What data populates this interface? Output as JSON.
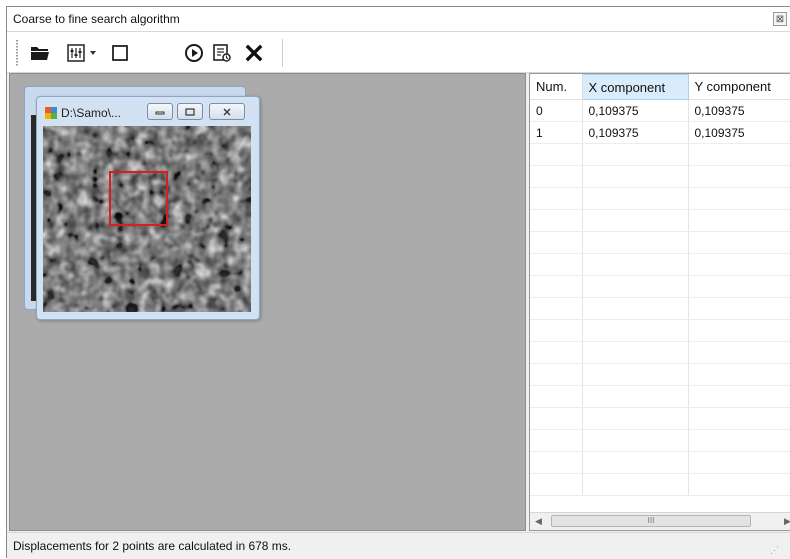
{
  "window": {
    "title": "Coarse to fine search algorithm",
    "title_button_glyph": "⊠"
  },
  "toolbar": {
    "buttons": [
      {
        "name": "open-folder-icon"
      },
      {
        "name": "settings-sliders-icon",
        "has_dropdown": true
      },
      {
        "name": "rectangle-select-icon"
      },
      {
        "name": "play-circle-icon"
      },
      {
        "name": "report-list-icon"
      },
      {
        "name": "close-x-icon"
      }
    ]
  },
  "image_window": {
    "title": "D:\\Samo\\...",
    "roi_color": "#d61f1f"
  },
  "grid": {
    "columns": [
      "Num.",
      "X component",
      "Y component"
    ],
    "highlighted_column": "X component",
    "rows": [
      [
        "0",
        "0,109375",
        "0,109375"
      ],
      [
        "1",
        "0,109375",
        "0,109375"
      ]
    ],
    "scroll_thumb_label": "III"
  },
  "status": {
    "text": "Displacements for 2 points are calculated in 678 ms."
  },
  "colors": {
    "mdi_background": "#ababab",
    "header_highlight": "#d9ecfb",
    "child_frame": "#d2e2f3"
  }
}
